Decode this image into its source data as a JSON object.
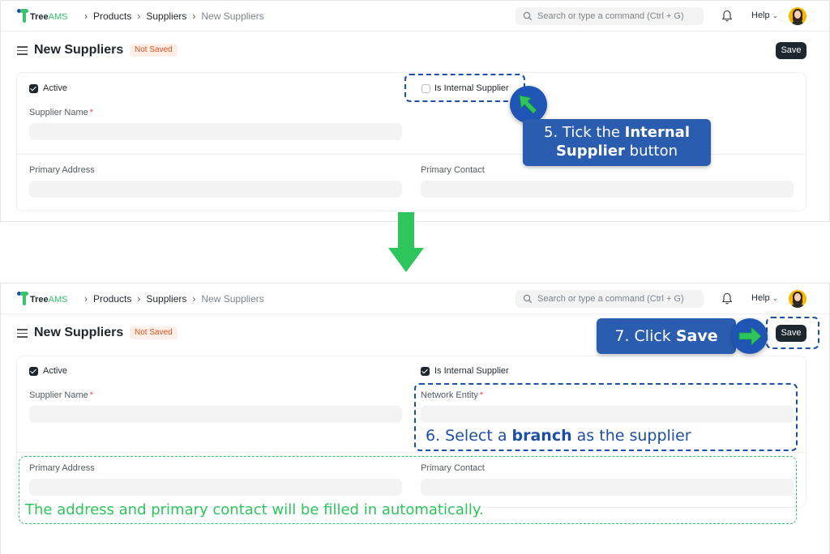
{
  "app": {
    "logo_tree": "Tree",
    "logo_ams": "AMS"
  },
  "breadcrumb": [
    "Products",
    "Suppliers",
    "New Suppliers"
  ],
  "search": {
    "placeholder": "Search or type a command (Ctrl + G)"
  },
  "help_label": "Help",
  "page": {
    "title": "New Suppliers",
    "status": "Not Saved",
    "save_label": "Save"
  },
  "form": {
    "active_label": "Active",
    "internal_label": "Is Internal Supplier",
    "supplier_name_label": "Supplier Name",
    "network_entity_label": "Network Entity",
    "required_mark": "*",
    "primary_address_label": "Primary Address",
    "primary_contact_label": "Primary Contact"
  },
  "states": {
    "before": {
      "active": true,
      "internal": false
    },
    "after": {
      "active": true,
      "internal": true
    }
  },
  "annotations": {
    "step5_pre": "5. Tick the ",
    "step5_bold": "Internal Supplier",
    "step5_post": " button",
    "step6_pre": "6. Select a ",
    "step6_bold": "branch",
    "step6_post": " as the supplier",
    "step7_pre": "7. Click ",
    "step7_bold": "Save",
    "autofill_note": "The address and primary contact will be filled in automatically."
  },
  "colors": {
    "callout_blue": "#2a5db0",
    "dashed_blue": "#1d4fa8",
    "accent_green": "#2ec55c",
    "status_orange": "#e0521b",
    "primary_dark": "#1f272e"
  },
  "icons": [
    "tree-logo-icon",
    "chevron-right-icon",
    "search-icon",
    "bell-icon",
    "chevron-down-icon",
    "hamburger-icon",
    "checkbox-icon",
    "arrow-down-icon",
    "pointer-arrow-icon"
  ]
}
